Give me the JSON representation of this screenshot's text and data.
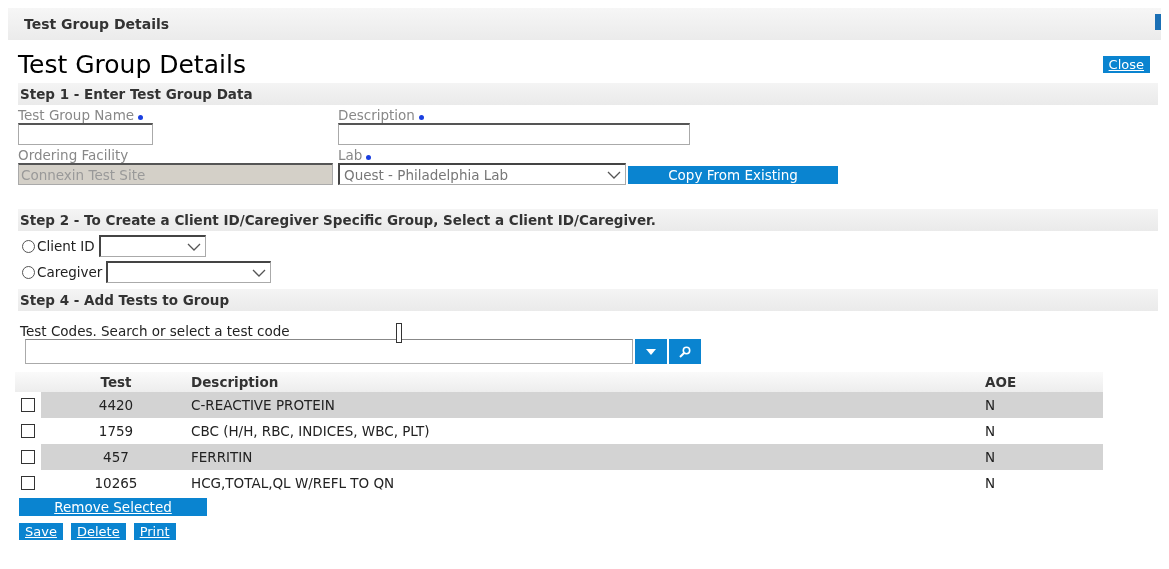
{
  "window": {
    "title": "Test Group Details"
  },
  "heading": "Test Group Details",
  "close_button": "Close",
  "step1": {
    "title": "Step 1 - Enter Test Group Data",
    "fields": [
      {
        "label": "Test Group Name",
        "required": true,
        "kind": "text"
      },
      {
        "label": "Description",
        "required": true,
        "kind": "text"
      },
      {
        "label": "Ordering Facility",
        "required": false,
        "kind": "disabled",
        "value": "Connexin Test Site"
      },
      {
        "label": "Lab",
        "required": true,
        "kind": "select",
        "value": "Quest - Philadelphia Lab"
      }
    ],
    "copy_button": "Copy From Existing"
  },
  "step2": {
    "title": "Step 2 - To Create a Client ID/Caregiver Specific Group, Select a Client ID/Caregiver.",
    "options": [
      {
        "label": "Client ID",
        "selected": false
      },
      {
        "label": "Caregiver",
        "selected": false
      }
    ]
  },
  "step4": {
    "title": "Step 4 - Add Tests to Group",
    "search_label": "Test Codes. Search or select a test code"
  },
  "table": {
    "columns": [
      "Test",
      "Description",
      "AOE"
    ],
    "rows": [
      {
        "test": "4420",
        "description": "C-REACTIVE PROTEIN",
        "aoe": "N",
        "checked": false
      },
      {
        "test": "1759",
        "description": "CBC (H/H, RBC, INDICES, WBC, PLT)",
        "aoe": "N",
        "checked": false
      },
      {
        "test": "457",
        "description": "FERRITIN",
        "aoe": "N",
        "checked": false
      },
      {
        "test": "10265",
        "description": "HCG,TOTAL,QL W/REFL TO QN",
        "aoe": "N",
        "checked": false
      }
    ]
  },
  "remove_button": "Remove Selected",
  "actions": [
    "Save",
    "Delete",
    "Print"
  ]
}
